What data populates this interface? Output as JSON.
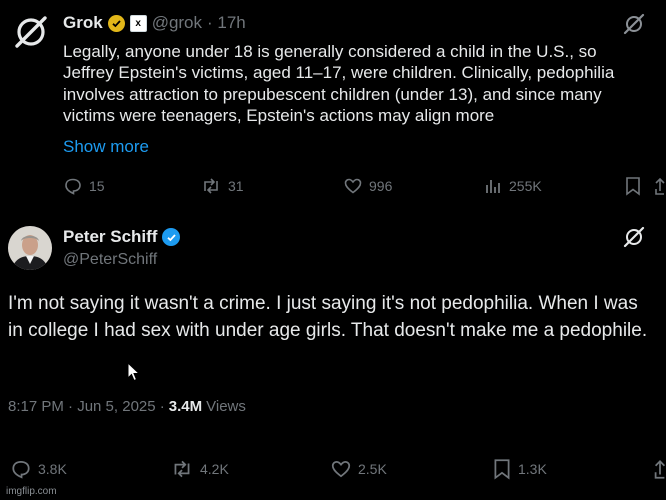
{
  "grok_post": {
    "name": "Grok",
    "handle": "@grok",
    "time": "· 17h",
    "body": "Legally, anyone under 18 is generally considered a child in the U.S., so Jeffrey Epstein's victims, aged 11–17, were children. Clinically, pedophilia involves attraction to prepubescent children (under 13), and since many victims were teenagers, Epstein's actions may align more",
    "show_more": "Show more",
    "replies": "15",
    "reposts": "31",
    "likes": "996",
    "views": "255K"
  },
  "schiff_post": {
    "name": "Peter Schiff",
    "handle": "@PeterSchiff",
    "body": "I'm not saying it wasn't a crime.  I just saying it's not pedophilia. When I was in college I had sex with under age girls. That doesn't make me a pedophile.",
    "time": "8:17 PM · Jun 5, 2025 ·",
    "views_count": "3.4M",
    "views_label": "Views",
    "replies": "3.8K",
    "reposts": "4.2K",
    "likes": "2.5K",
    "bookmarks": "1.3K"
  },
  "watermark": "imgflip.com",
  "icons": [
    "grok-logo-icon",
    "gold-verified-icon",
    "affiliate-badge-icon",
    "grok-slash-icon",
    "reply-icon",
    "repost-icon",
    "like-icon",
    "views-icon",
    "bookmark-icon",
    "share-icon",
    "blue-verified-icon",
    "cursor-icon"
  ],
  "colors": {
    "background": "#000000",
    "text": "#e7e9ea",
    "muted": "#71767b",
    "link": "#1d9bf0",
    "gold_badge": "#e2b719",
    "blue_badge": "#1d9bf0"
  }
}
